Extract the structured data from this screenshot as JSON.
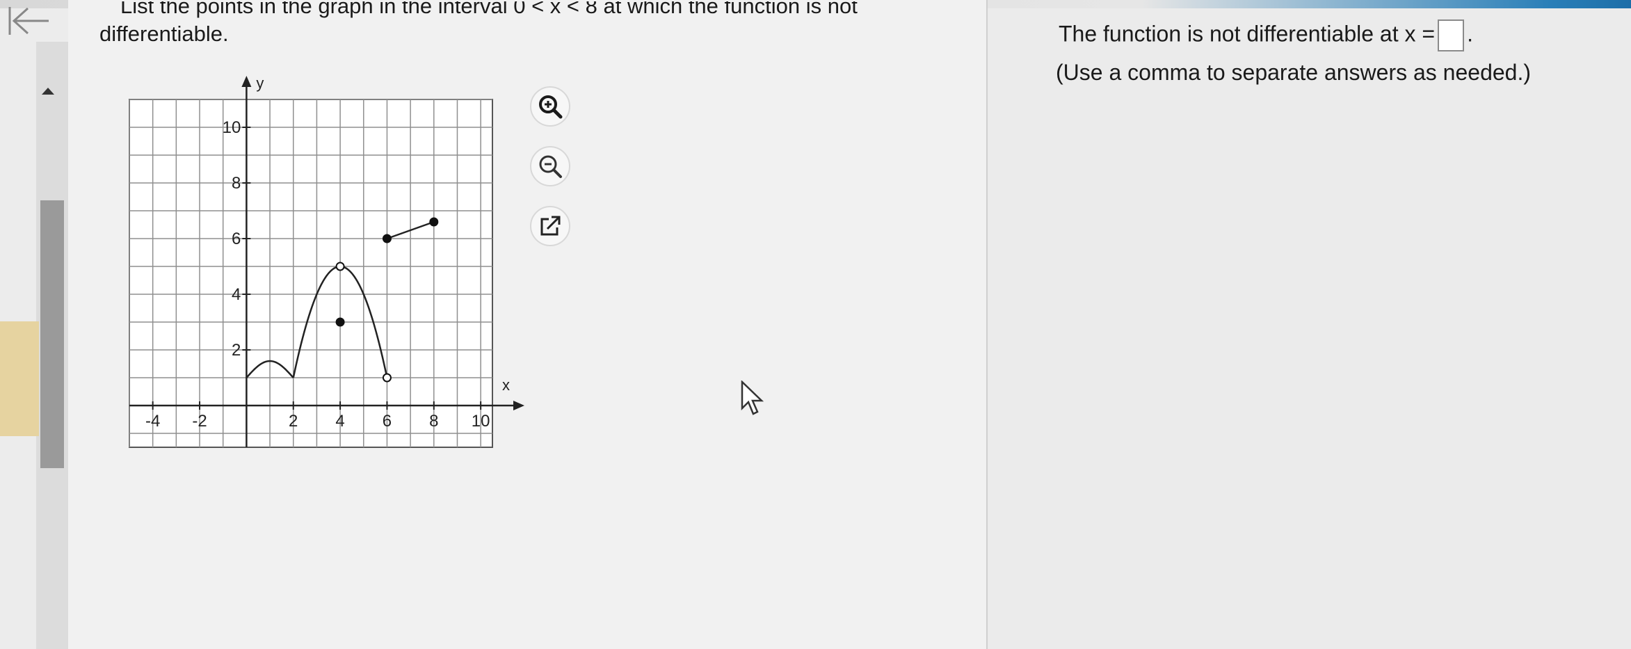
{
  "question": {
    "line1": "List the points in the graph in the interval 0 < x < 8 at which the function is not",
    "line2": "differentiable."
  },
  "graph": {
    "x_label": "x",
    "y_label": "y",
    "x_ticks": [
      "-4",
      "-2",
      "2",
      "4",
      "6",
      "8",
      "10"
    ],
    "y_ticks": [
      "10",
      "8",
      "6",
      "4",
      "2"
    ]
  },
  "tools": {
    "zoom_in": "zoom-in-icon",
    "zoom_out": "zoom-out-icon",
    "open_new": "external-link-icon"
  },
  "answer": {
    "prompt": "The function is not differentiable at x =",
    "after_box": ".",
    "hint": "(Use a comma to separate answers as needed.)"
  },
  "colors": {
    "accent": "#1d6ea8",
    "rail_thumb": "#9a9a9a"
  }
}
